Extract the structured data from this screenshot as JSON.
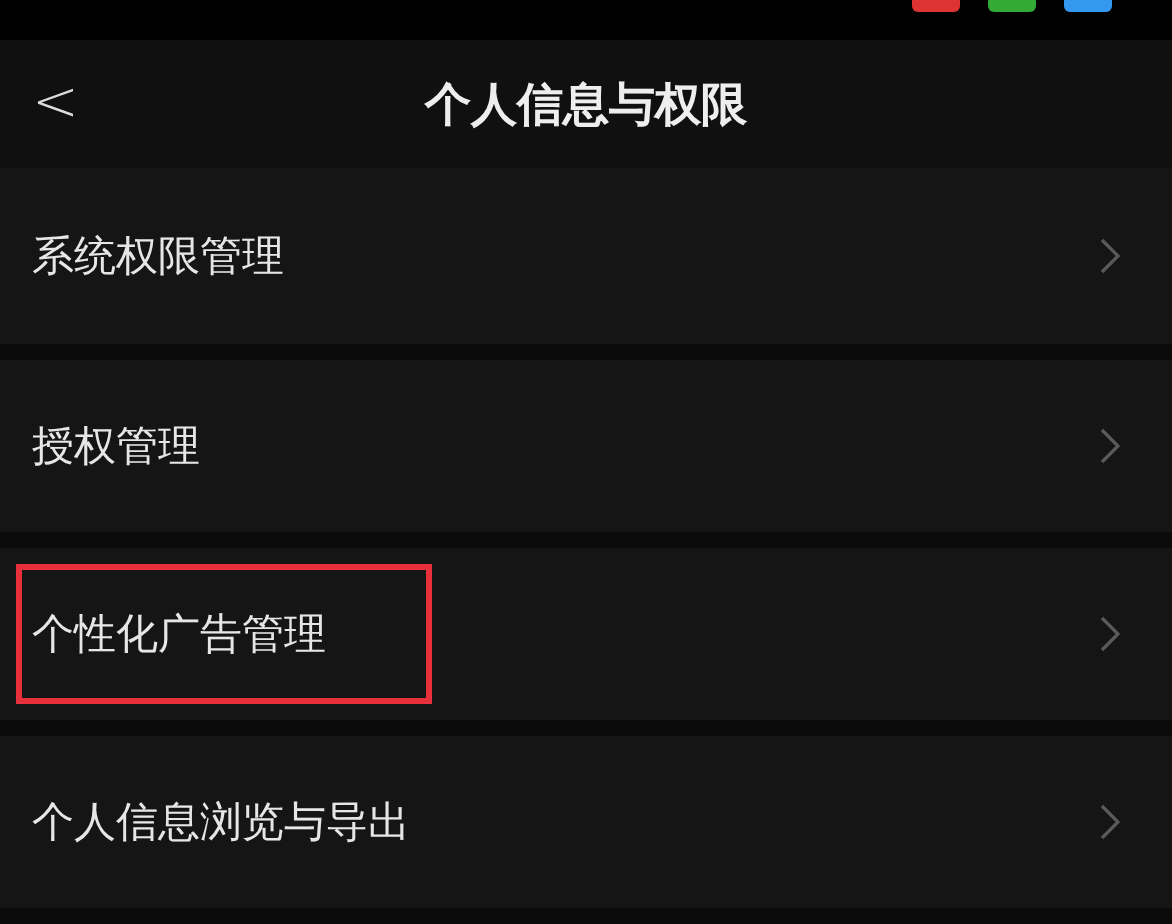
{
  "nav_bar": {
    "back": "<",
    "title": "个人信息与权限"
  },
  "items": [
    {
      "label": "系统权限管理",
      "highlighted": false
    },
    {
      "label": "授权管理",
      "highlighted": false
    },
    {
      "label": "个性化广告管理",
      "highlighted": true
    },
    {
      "label": "个人信息浏览与导出",
      "highlighted": false
    }
  ]
}
